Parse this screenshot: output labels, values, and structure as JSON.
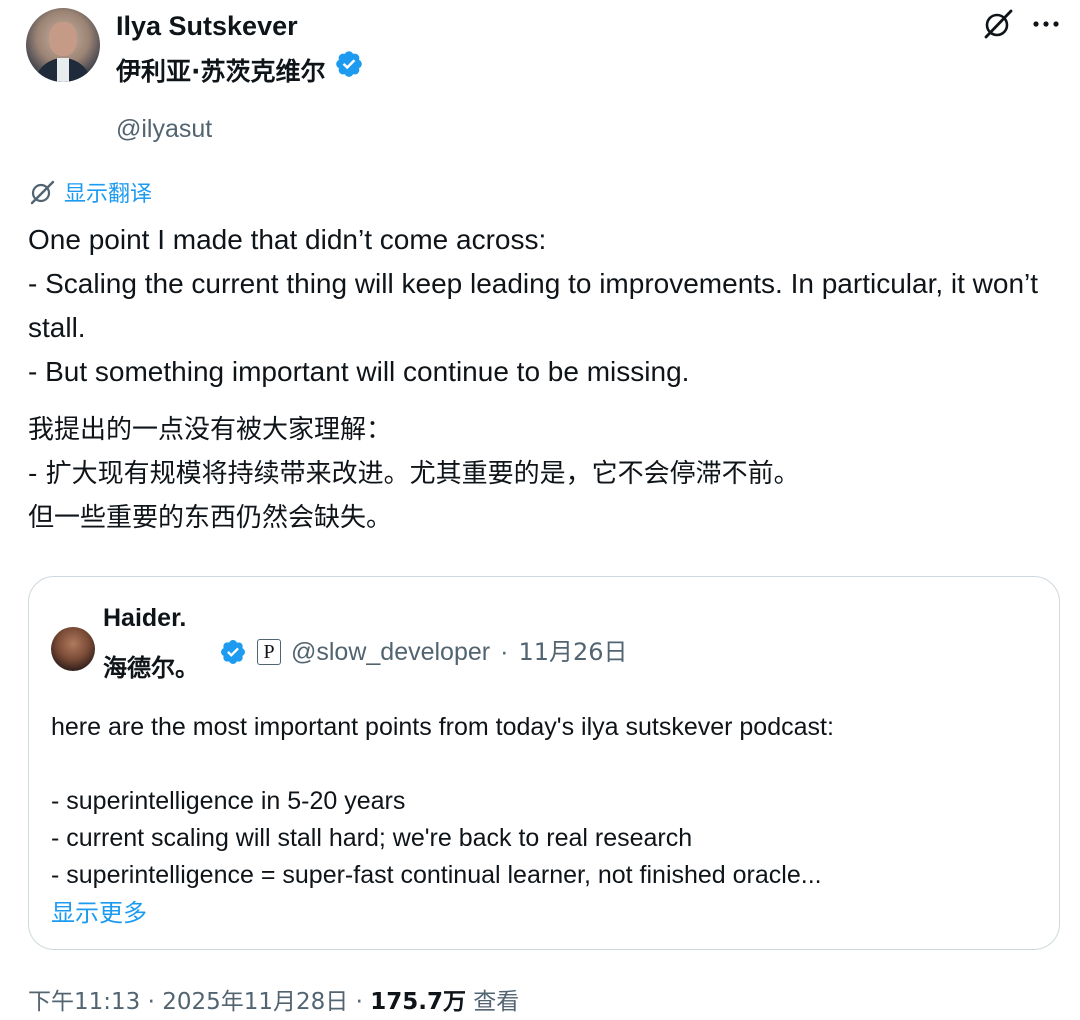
{
  "author": {
    "name": "Ilya Sutskever",
    "name_zh": "伊利亚·苏茨克维尔",
    "handle": "@ilyasut"
  },
  "icons": [
    "grok-icon",
    "more-icon",
    "verified-icon",
    "translate-icon"
  ],
  "colors": {
    "accent": "#1d9bf0",
    "text": "#0f1419",
    "secondary": "#536471",
    "border": "#cfd9de"
  },
  "translate_link": "显示翻译",
  "tweet": {
    "en_lines": [
      "One point I made that didn’t come across:",
      "- Scaling the current thing will keep leading to improvements.  In particular, it won’t stall.",
      "- But something important will continue to be missing."
    ],
    "zh_lines": [
      "我提出的一点没有被大家理解：",
      "- 扩大现有规模将持续带来改进。尤其重要的是，它不会停滞不前。",
      "但一些重要的东西仍然会缺失。"
    ]
  },
  "quote": {
    "name": "Haider.",
    "name_zh": "海德尔。",
    "badge": "P",
    "handle": "@slow_developer",
    "separator": "·",
    "date": "11月26日",
    "intro": "here are the most important points from today's ilya sutskever podcast:",
    "points": [
      "- superintelligence in 5-20 years",
      "- current scaling will stall hard; we're back to real research",
      "- superintelligence = super-fast continual learner, not finished oracle..."
    ],
    "show_more": "显示更多"
  },
  "footer": {
    "time": "下午11:13 · 2025年11月28日 · ",
    "views": "175.7万",
    "views_label": " 查看"
  }
}
